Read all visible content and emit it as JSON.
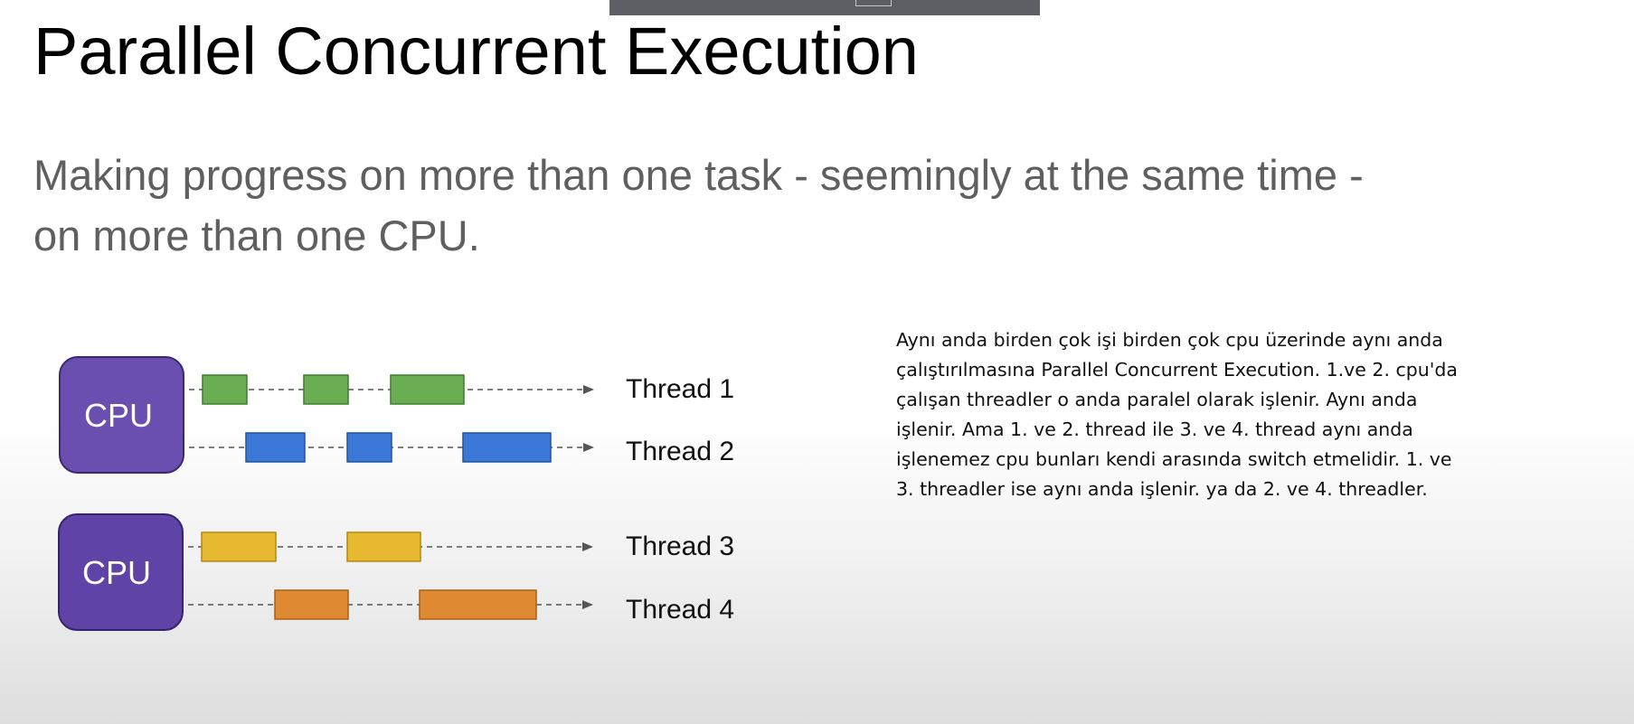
{
  "title": "Parallel Concurrent Execution",
  "subtitle_lines": [
    "Making progress on more than one task - seemingly at the same time -",
    "on more than one CPU."
  ],
  "diagram": {
    "cpus": [
      {
        "label": "CPU",
        "color": "#6a4fb0"
      },
      {
        "label": "CPU",
        "color": "#5f43a6"
      }
    ],
    "threads": [
      {
        "label": "Thread 1",
        "cpu": 0,
        "color": "#6aad52",
        "border": "#3f7f2e"
      },
      {
        "label": "Thread 2",
        "cpu": 0,
        "color": "#3c78d8",
        "border": "#23559e"
      },
      {
        "label": "Thread 3",
        "cpu": 1,
        "color": "#e6b930",
        "border": "#b08a12"
      },
      {
        "label": "Thread 4",
        "cpu": 1,
        "color": "#df8a33",
        "border": "#a95f17"
      }
    ],
    "line_color": "#555555"
  },
  "note_lines": [
    "Aynı anda birden çok işi birden çok cpu üzerinde aynı anda",
    "çalıştırılmasına Parallel Concurrent Execution. 1.ve 2. cpu'da",
    "çalışan threadler o anda paralel olarak işlenir. Aynı anda",
    "işlenir. Ama 1. ve 2. thread ile 3. ve 4. thread aynı anda",
    "işlenemez cpu bunları kendi arasında switch etmelidir. 1. ve",
    "3. threadler ise aynı anda işlenir. ya da 2. ve 4. threadler."
  ]
}
